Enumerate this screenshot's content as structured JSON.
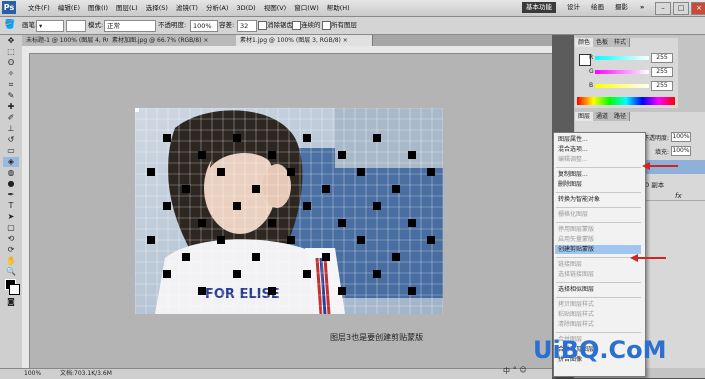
{
  "menubar": {
    "app_icon": "Ps",
    "items": [
      "文件(F)",
      "编辑(E)",
      "图像(I)",
      "图层(L)",
      "选择(S)",
      "滤镜(T)",
      "分析(A)",
      "3D(D)",
      "视图(V)",
      "窗口(W)",
      "帮助(H)"
    ],
    "workspaces": [
      "基本功能",
      "设计",
      "绘画",
      "摄影",
      "»"
    ]
  },
  "options": {
    "brush_label": "画笔:",
    "mode_label": "模式:",
    "mode_value": "正常",
    "opacity_label": "不透明度:",
    "opacity_value": "100%",
    "tolerance_label": "容差:",
    "tolerance_value": "32",
    "antialias_label": "消除锯齿",
    "contiguous_label": "连续的",
    "all_layers_label": "所有图层"
  },
  "tabs": [
    {
      "label": "未标题-1 @ 100% (图层 4, RGB/8) ×",
      "active": false
    },
    {
      "label": "素材加图.jpg @ 66.7% (RGB/8) ×",
      "active": false
    },
    {
      "label": "素材1.jpg @ 100% (图层 3, RGB/8) ×",
      "active": true
    }
  ],
  "caption": "图层3也是要创建剪贴蒙版",
  "status": {
    "zoom": "100%",
    "doc_info": "文档:703.1K/3.6M"
  },
  "color_panel": {
    "tabs": [
      "颜色",
      "色板",
      "样式"
    ],
    "r_label": "R",
    "r_value": "255",
    "g_label": "G",
    "g_value": "255",
    "b_label": "B",
    "b_value": "255"
  },
  "layers_panel": {
    "tabs": [
      "图层",
      "通道",
      "路径"
    ],
    "opacity_label": "不透明度:",
    "opacity_value": "100%",
    "fill_label": "填充:",
    "fill_value": "100%",
    "layer_copy_label": "0 副本",
    "fx_label": "fx"
  },
  "context_menu": {
    "items": [
      {
        "label": "图层属性...",
        "enabled": true
      },
      {
        "label": "混合选项...",
        "enabled": true
      },
      {
        "label": "编辑调整...",
        "enabled": false
      },
      {
        "sep": true
      },
      {
        "label": "复制图层...",
        "enabled": true
      },
      {
        "label": "删除图层",
        "enabled": true
      },
      {
        "sep": true
      },
      {
        "label": "转换为智能对象",
        "enabled": true
      },
      {
        "sep": true
      },
      {
        "label": "栅格化图层",
        "enabled": false
      },
      {
        "sep": true
      },
      {
        "label": "停用图层蒙版",
        "enabled": false
      },
      {
        "label": "启用矢量蒙版",
        "enabled": false
      },
      {
        "label": "创建剪贴蒙版",
        "enabled": true,
        "highlight": true
      },
      {
        "sep": true
      },
      {
        "label": "链接图层",
        "enabled": false
      },
      {
        "label": "选择链接图层",
        "enabled": false
      },
      {
        "sep": true
      },
      {
        "label": "选择相似图层",
        "enabled": true
      },
      {
        "sep": true
      },
      {
        "label": "拷贝图层样式",
        "enabled": false
      },
      {
        "label": "粘贴图层样式",
        "enabled": false
      },
      {
        "label": "清除图层样式",
        "enabled": false
      },
      {
        "sep": true
      },
      {
        "label": "合并图层",
        "enabled": false
      },
      {
        "label": "合并可见图层",
        "enabled": true
      },
      {
        "label": "拼合图像",
        "enabled": true
      }
    ]
  },
  "watermark": "UiBQ.CoM",
  "taskbar": [
    "中",
    "°",
    "☺"
  ],
  "colors": {
    "highlight": "#9ec6f0",
    "arrow": "#d32424",
    "accent": "#2b6fd1"
  }
}
